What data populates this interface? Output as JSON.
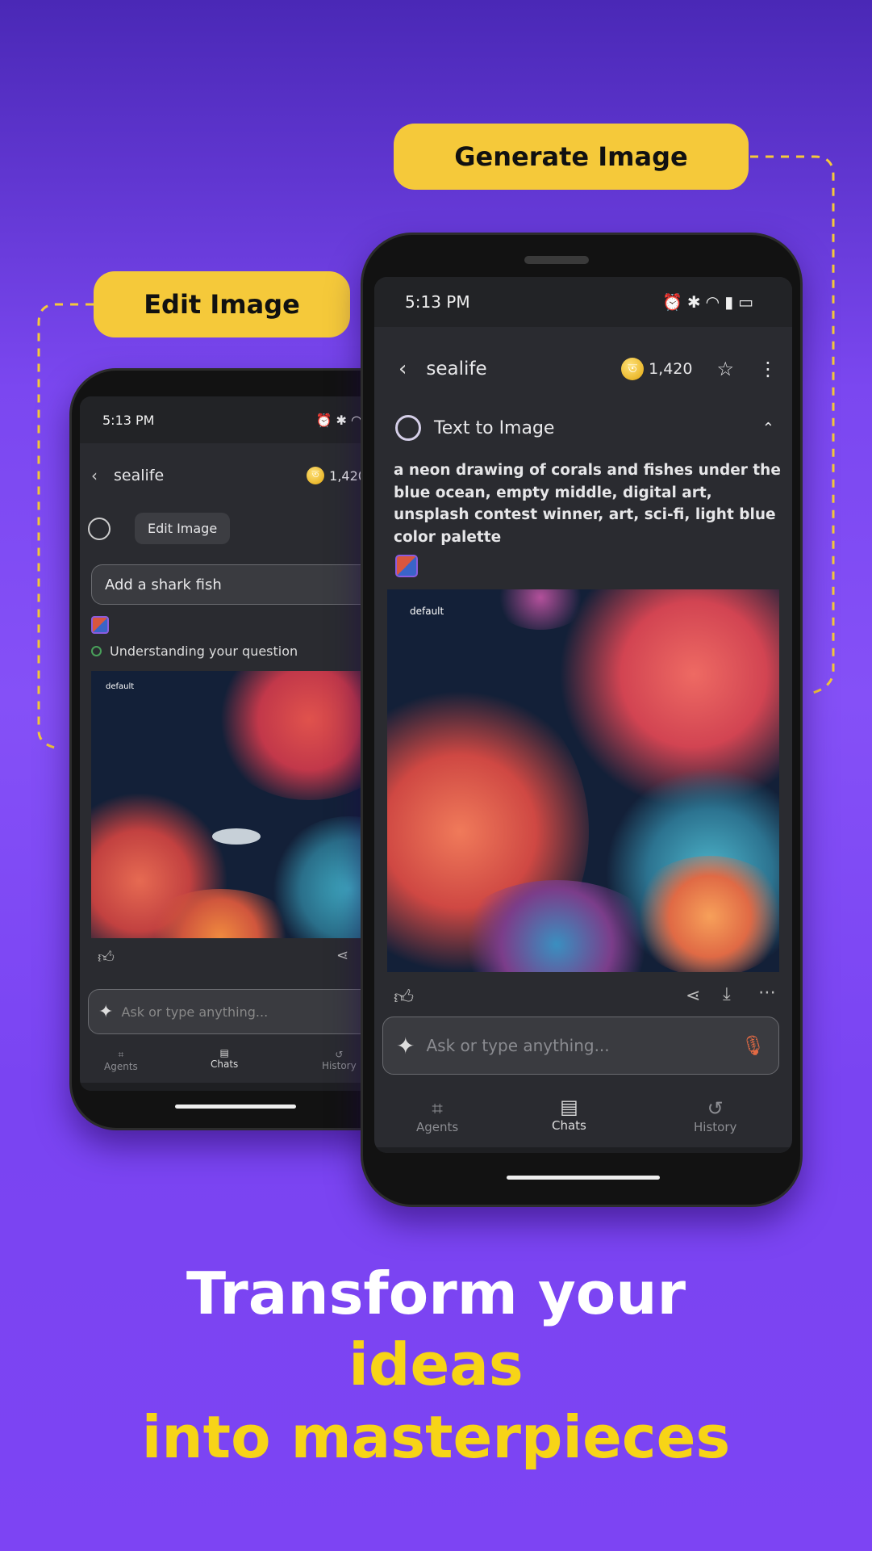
{
  "callouts": {
    "generate": "Generate Image",
    "edit": "Edit Image"
  },
  "headline": {
    "line1": "Transform your",
    "line2": "ideas",
    "line3": "into masterpieces"
  },
  "colors": {
    "accent": "#f5c93a",
    "background": "#7b47f0",
    "screen": "#2a2b30"
  },
  "right_phone": {
    "status_time": "5:13 PM",
    "status_icons": [
      "alarm-icon",
      "bluetooth-icon",
      "wifi-icon",
      "signal-icon",
      "battery-icon"
    ],
    "chat_title": "sealife",
    "coins": "1,420",
    "agent_label": "Text to Image",
    "prompt": "a neon drawing of corals and fishes under the blue ocean, empty middle, digital art, unsplash contest winner, art, sci-fi, light blue color palette",
    "image_label": "default",
    "input_placeholder": "Ask or type anything...",
    "nav": [
      {
        "label": "Agents",
        "icon": "chip-icon"
      },
      {
        "label": "Chats",
        "icon": "chat-icon",
        "active": true
      },
      {
        "label": "History",
        "icon": "history-icon"
      }
    ]
  },
  "left_phone": {
    "status_time": "5:13 PM",
    "chat_title": "sealife",
    "coins": "1,420",
    "agent_chip": "Edit Image",
    "user_message": "Add a shark fish",
    "progress_status": "Understanding your question",
    "image_label": "default",
    "input_placeholder": "Ask or type anything...",
    "nav": [
      {
        "label": "Agents"
      },
      {
        "label": "Chats",
        "active": true
      },
      {
        "label": "History"
      }
    ]
  }
}
